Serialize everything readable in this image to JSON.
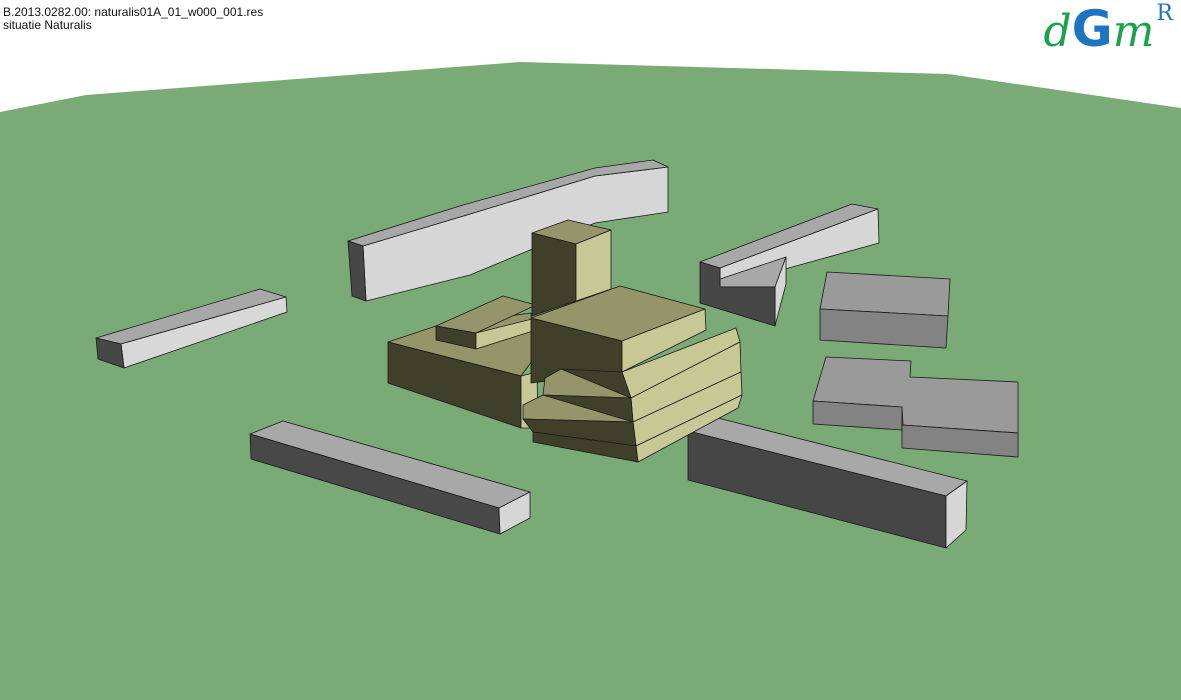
{
  "header": {
    "line1": "B.2013.0282.00: naturalis01A_01_w000_001.res",
    "line2": "situatie Naturalis"
  },
  "logo": {
    "d": "d",
    "g": "G",
    "m": "m",
    "r": "R"
  },
  "colors": {
    "ground": "#7aab77",
    "context_top": "#9b9b9b",
    "context_light": "#d4d4d4",
    "context_dark": "#484848",
    "new_light": "#c8c796",
    "new_top": "#96946a",
    "new_dark": "#3f3f2a"
  }
}
